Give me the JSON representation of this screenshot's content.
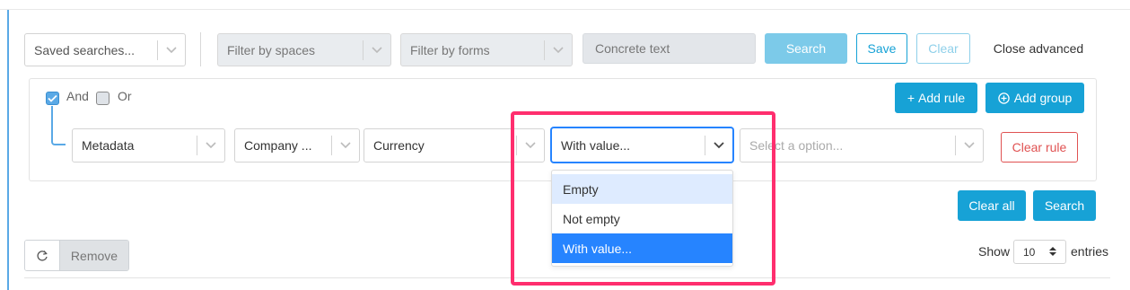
{
  "toolbar": {
    "saved_searches": "Saved searches...",
    "filter_spaces": "Filter by spaces",
    "filter_forms": "Filter by forms",
    "concrete_text_placeholder": "Concrete text",
    "search_label": "Search",
    "save_label": "Save",
    "clear_label": "Clear",
    "close_advanced_label": "Close advanced"
  },
  "builder": {
    "and_label": "And",
    "or_label": "Or",
    "and_checked": true,
    "or_checked": false,
    "add_rule_label": "Add rule",
    "add_group_label": "Add group",
    "rule": {
      "field1": "Metadata",
      "field2": "Company ...",
      "field3": "Currency",
      "operator": "With value...",
      "value_placeholder": "Select a option...",
      "clear_rule_label": "Clear rule"
    }
  },
  "operator_options": [
    "Empty",
    "Not empty",
    "With value..."
  ],
  "operator_selected": "With value...",
  "actions": {
    "clear_all_label": "Clear all",
    "search_label": "Search"
  },
  "footer": {
    "remove_label": "Remove",
    "show_label": "Show",
    "entries_value": "10",
    "entries_label": "entries"
  },
  "colors": {
    "primary": "#17a2d6",
    "highlight": "#ff2e6e",
    "option_selected": "#2684ff",
    "option_hover": "#deebff",
    "danger": "#e05252"
  }
}
